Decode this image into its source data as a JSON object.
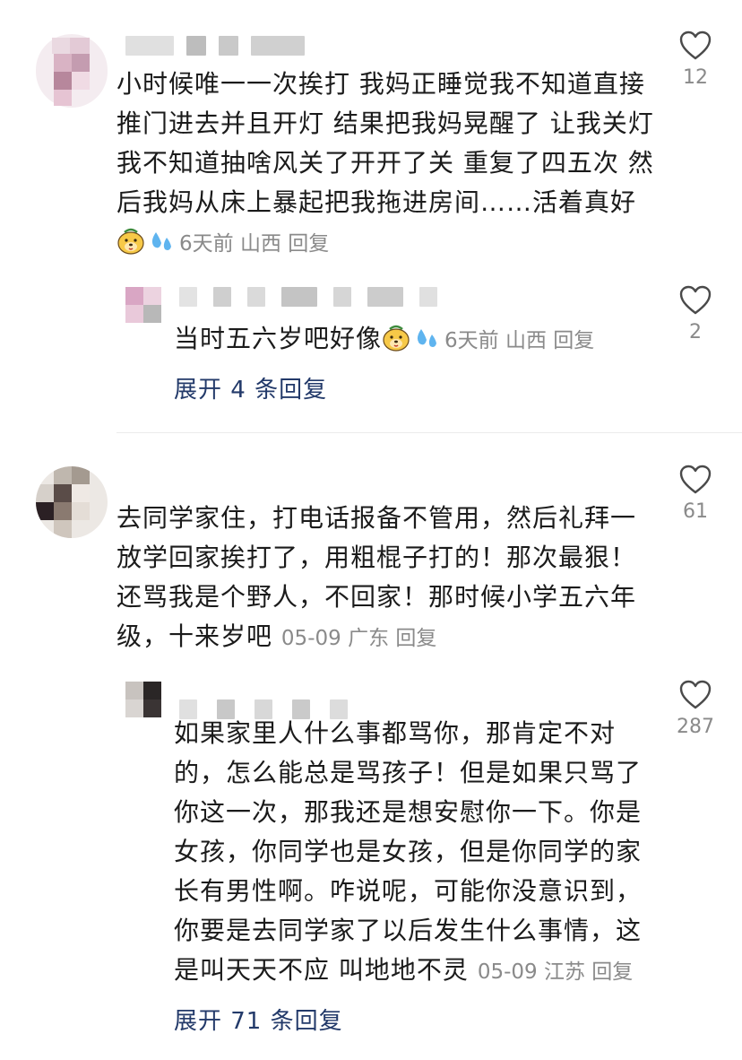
{
  "comments": [
    {
      "text": "小时候唯一一次挨打 我妈正睡觉我不知道直接推门进去并且开灯 结果把我妈晃醒了 让我关灯我不知道抽啥风关了开开了关 重复了四五次 然后我妈从床上暴起把我拖进房间……活着真好",
      "lines": [
        "小时候唯一一次挨打 我妈正睡觉我不知道直接",
        "推门进去并且开灯 结果把我妈晃醒了 让我关灯",
        "我不知道抽啥风关了开开了关 重复了四五次 然",
        "后我妈从床上暴起把我拖进房间……活着真好"
      ],
      "emojis": [
        "dog-face-emoji",
        "sweat-drops-emoji"
      ],
      "time": "6天前",
      "location": "山西",
      "reply_label": "回复",
      "likes": "12",
      "reply": {
        "text": "当时五六岁吧好像",
        "emojis": [
          "dog-face-emoji",
          "sweat-drops-emoji"
        ],
        "time": "6天前",
        "location": "山西",
        "reply_label": "回复",
        "likes": "2"
      },
      "expand_label": "展开 4 条回复"
    },
    {
      "text": "去同学家住，打电话报备不管用，然后礼拜一放学回家挨打了，用粗棍子打的！那次最狠！还骂我是个野人，不回家！那时候小学五六年级，十来岁吧",
      "lines": [
        "去同学家住，打电话报备不管用，然后礼拜一",
        "放学回家挨打了，用粗棍子打的！那次最狠！",
        "还骂我是个野人，不回家！那时候小学五六年",
        "级，十来岁吧"
      ],
      "time": "05-09",
      "location": "广东",
      "reply_label": "回复",
      "likes": "61",
      "reply": {
        "text": "如果家里人什么事都骂你，那肯定不对的，怎么能总是骂孩子！但是如果只骂了你这一次，那我还是想安慰你一下。你是女孩，你同学也是女孩，但是你同学的家长有男性啊。咋说呢，可能你没意识到，你要是去同学家了以后发生什么事情，这是叫天天不应 叫地地不灵",
        "lines": [
          "如果家里人什么事都骂你，那肯定不对",
          "的，怎么能总是骂孩子！但是如果只骂了",
          "你这一次，那我还是想安慰你一下。你是",
          "女孩，你同学也是女孩，但是你同学的家",
          "长有男性啊。咋说呢，可能你没意识到，",
          "你要是去同学家了以后发生什么事情，这",
          "是叫天天不应 叫地地不灵"
        ],
        "time": "05-09",
        "location": "江苏",
        "reply_label": "回复",
        "likes": "287"
      },
      "expand_label": "展开 71 条回复"
    }
  ],
  "colors": {
    "text": "#1b1b1b",
    "meta": "#8a8a8a",
    "expand": "#233a6a",
    "divider": "#ececec"
  },
  "icons": [
    "heart-outline-icon"
  ]
}
